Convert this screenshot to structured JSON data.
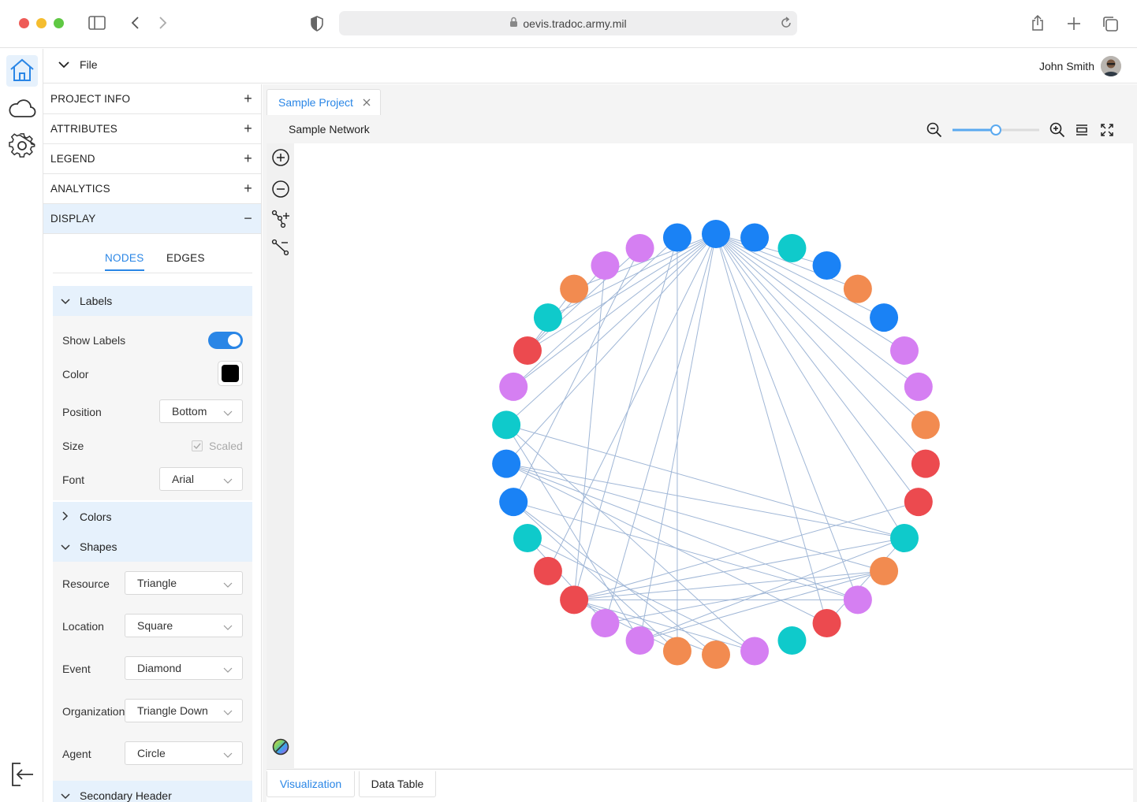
{
  "browser": {
    "url": "oevis.tradoc.army.mil",
    "icons": [
      "sidebar-icon",
      "back-icon",
      "forward-icon",
      "shield-icon",
      "lock-icon",
      "reload-icon",
      "share-icon",
      "new-tab-icon",
      "tabs-icon"
    ]
  },
  "rail": {
    "items": [
      "home-icon",
      "cloud-icon",
      "settings-icon",
      "logout-icon"
    ],
    "active": "home-icon",
    "accent": "#2a86e6"
  },
  "appbar": {
    "file_label": "File",
    "user_name": "John Smith"
  },
  "panel": {
    "accordions": [
      {
        "label": "PROJECT INFO",
        "sign": "+"
      },
      {
        "label": "ATTRIBUTES",
        "sign": "+"
      },
      {
        "label": "LEGEND",
        "sign": "+"
      },
      {
        "label": "ANALYTICS",
        "sign": "+"
      },
      {
        "label": "DISPLAY",
        "sign": "−"
      }
    ],
    "subtabs": {
      "nodes": "NODES",
      "edges": "EDGES"
    },
    "labels_section": {
      "title": "Labels",
      "show_labels": "Show Labels",
      "show_labels_on": true,
      "color": "Color",
      "color_value": "#000000",
      "position": "Position",
      "position_value": "Bottom",
      "size": "Size",
      "size_value": "Scaled",
      "font": "Font",
      "font_value": "Arial"
    },
    "colors_section": {
      "title": "Colors"
    },
    "shapes_section": {
      "title": "Shapes",
      "rows": [
        {
          "label": "Resource",
          "value": "Triangle"
        },
        {
          "label": "Location",
          "value": "Square"
        },
        {
          "label": "Event",
          "value": "Diamond"
        },
        {
          "label": "Organization",
          "value": "Triangle Down"
        },
        {
          "label": "Agent",
          "value": "Circle"
        }
      ]
    },
    "secondary_header": "Secondary Header"
  },
  "workspace": {
    "project_tab": "Sample Project",
    "network_title": "Sample Network",
    "zoom_level": 0.5,
    "bottom_tabs": [
      "Visualization",
      "Data Table"
    ],
    "active_bottom_tab": "Visualization"
  },
  "graph": {
    "palette": {
      "blue": "#1a82f5",
      "teal": "#0fcacb",
      "orange": "#f28b50",
      "violet": "#d57ff2",
      "red": "#ec4a4f",
      "edge": "#9fb6d6"
    },
    "nodes": [
      "blue",
      "blue",
      "teal",
      "blue",
      "orange",
      "blue",
      "violet",
      "violet",
      "orange",
      "red",
      "red",
      "teal",
      "orange",
      "violet",
      "red",
      "teal",
      "violet",
      "orange",
      "orange",
      "violet",
      "violet",
      "red",
      "red",
      "teal",
      "blue",
      "blue",
      "teal",
      "violet",
      "red",
      "teal",
      "orange",
      "violet",
      "violet",
      "blue"
    ],
    "edges": [
      [
        0,
        30
      ],
      [
        0,
        29
      ],
      [
        0,
        28
      ],
      [
        0,
        27
      ],
      [
        0,
        26
      ],
      [
        0,
        25
      ],
      [
        0,
        20
      ],
      [
        0,
        22
      ],
      [
        0,
        19
      ],
      [
        0,
        14
      ],
      [
        0,
        13
      ],
      [
        0,
        11
      ],
      [
        0,
        10
      ],
      [
        0,
        9
      ],
      [
        0,
        8
      ],
      [
        0,
        7
      ],
      [
        0,
        6
      ],
      [
        0,
        5
      ],
      [
        0,
        4
      ],
      [
        0,
        3
      ],
      [
        33,
        18
      ],
      [
        33,
        21
      ],
      [
        33,
        27
      ],
      [
        32,
        24
      ],
      [
        32,
        28
      ],
      [
        31,
        28
      ],
      [
        31,
        21
      ],
      [
        30,
        28
      ],
      [
        25,
        11
      ],
      [
        25,
        12
      ],
      [
        25,
        13
      ],
      [
        25,
        14
      ],
      [
        21,
        10
      ],
      [
        21,
        11
      ],
      [
        21,
        12
      ],
      [
        21,
        13
      ],
      [
        21,
        17
      ],
      [
        21,
        16
      ],
      [
        21,
        18
      ],
      [
        19,
        11
      ],
      [
        19,
        12
      ],
      [
        24,
        13
      ],
      [
        24,
        18
      ],
      [
        24,
        17
      ],
      [
        23,
        16
      ],
      [
        23,
        20
      ],
      [
        26,
        16
      ],
      [
        26,
        19
      ],
      [
        26,
        11
      ],
      [
        20,
        12
      ],
      [
        14,
        11
      ]
    ]
  }
}
